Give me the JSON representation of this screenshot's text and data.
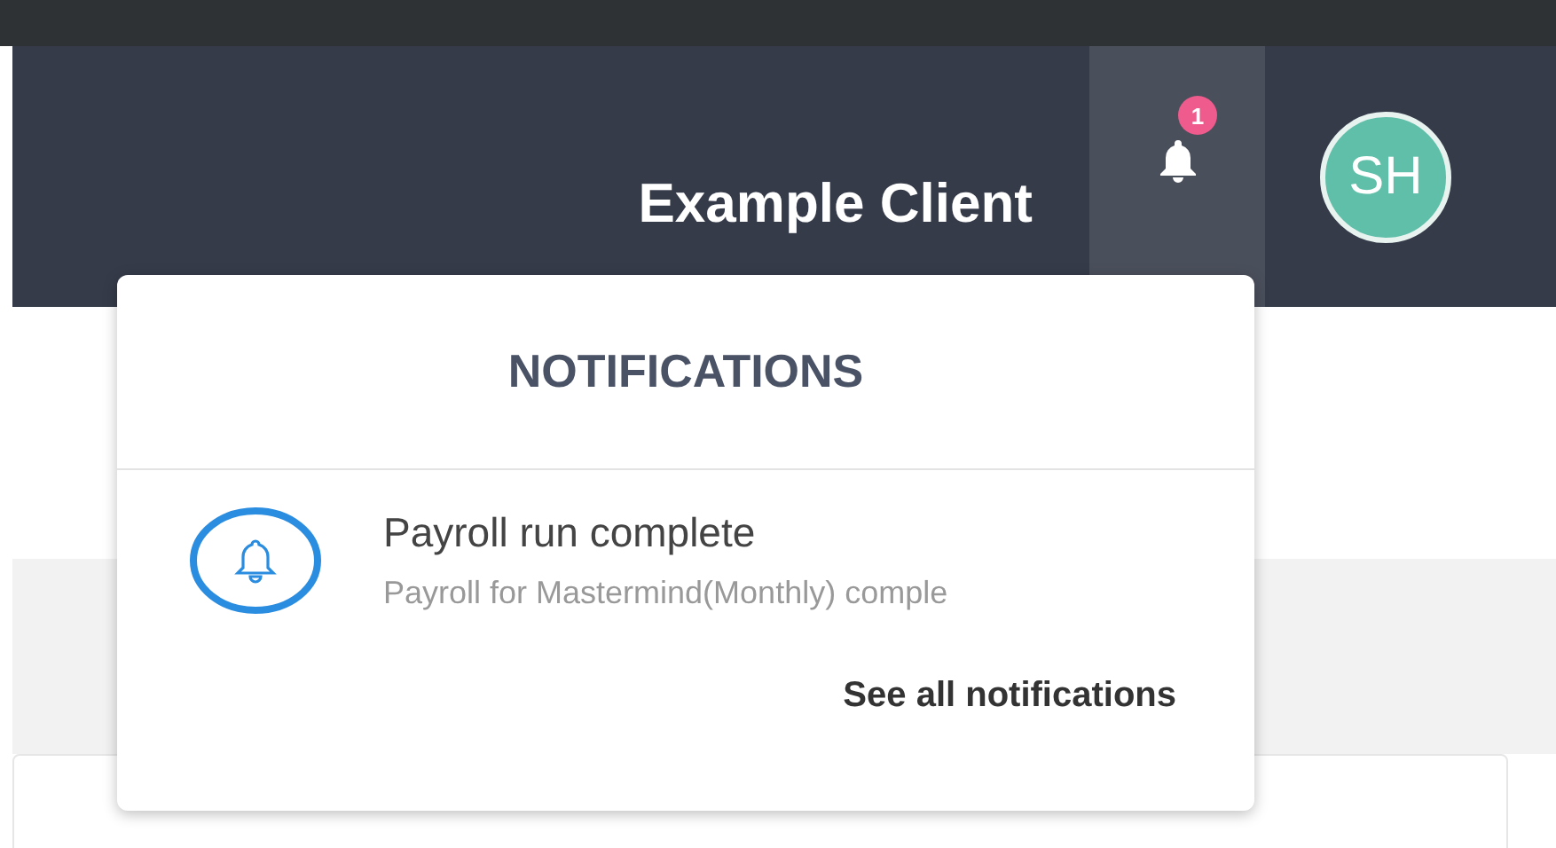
{
  "header": {
    "client_name": "Example Client",
    "notification_count": "1",
    "avatar_initials": "SH"
  },
  "notifications_panel": {
    "title": "NOTIFICATIONS",
    "items": [
      {
        "title": "Payroll run complete",
        "description": "Payroll for Mastermind(Monthly) comple"
      }
    ],
    "footer_link": "See all notifications"
  }
}
